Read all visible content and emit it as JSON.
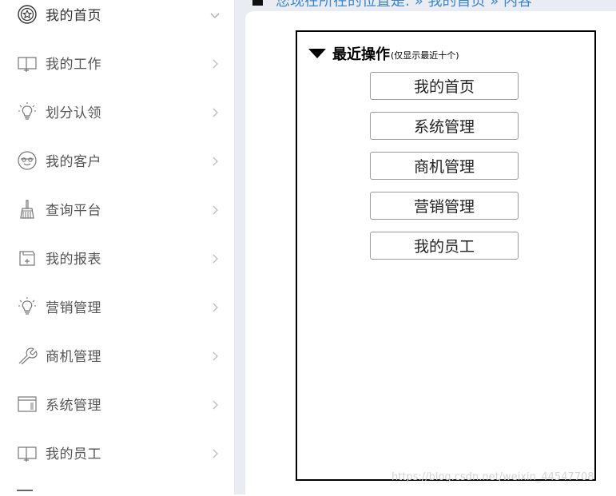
{
  "sidebar": {
    "items": [
      {
        "label": "我的首页",
        "icon": "star-badge-icon",
        "chevron": "chevron-down-icon"
      },
      {
        "label": "我的工作",
        "icon": "book-icon",
        "chevron": "chevron-right-icon"
      },
      {
        "label": "划分认领",
        "icon": "lightbulb-icon",
        "chevron": "chevron-right-icon"
      },
      {
        "label": "我的客户",
        "icon": "face-icon",
        "chevron": "chevron-right-icon"
      },
      {
        "label": "查询平台",
        "icon": "brush-icon",
        "chevron": "chevron-right-icon"
      },
      {
        "label": "我的报表",
        "icon": "folder-plus-icon",
        "chevron": "chevron-right-icon"
      },
      {
        "label": "营销管理",
        "icon": "lightbulb-icon",
        "chevron": "chevron-right-icon"
      },
      {
        "label": "商机管理",
        "icon": "wrench-icon",
        "chevron": "chevron-right-icon"
      },
      {
        "label": "系统管理",
        "icon": "window-icon",
        "chevron": "chevron-right-icon"
      },
      {
        "label": "我的员工",
        "icon": "book-icon",
        "chevron": "chevron-right-icon"
      }
    ]
  },
  "breadcrumb": {
    "text": "您现在所在的位置是: » 我的首页 » 内容"
  },
  "recent": {
    "title": "最近操作",
    "note": "(仅显示最近十个)",
    "buttons": [
      "我的首页",
      "系统管理",
      "商机管理",
      "营销管理",
      "我的员工"
    ]
  },
  "watermark": "https://blog.csdn.net/weixin_44547708",
  "colors": {
    "breadcrumb": "#3f86c9",
    "main_bg": "#e9ecf3"
  }
}
